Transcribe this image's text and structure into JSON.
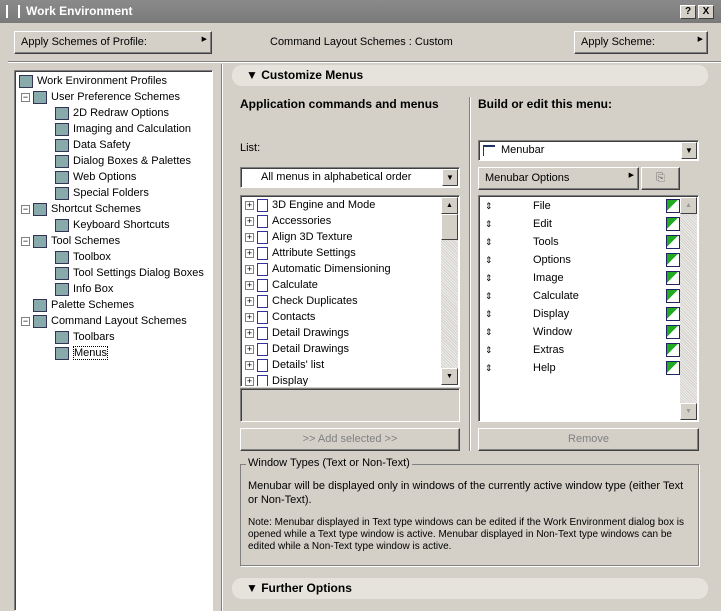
{
  "window": {
    "title": "Work Environment",
    "help": "?",
    "close": "X"
  },
  "toolbar": {
    "apply_profile": "Apply Schemes of Profile:",
    "layout_label": "Command Layout Schemes : Custom",
    "apply_scheme": "Apply Scheme:"
  },
  "tree": [
    {
      "label": "Work Environment Profiles",
      "level": 0,
      "exp": ""
    },
    {
      "label": "User Preference Schemes",
      "level": 1,
      "exp": "−"
    },
    {
      "label": "2D Redraw Options",
      "level": 2
    },
    {
      "label": "Imaging and Calculation",
      "level": 2
    },
    {
      "label": "Data Safety",
      "level": 2
    },
    {
      "label": "Dialog Boxes & Palettes",
      "level": 2
    },
    {
      "label": "Web Options",
      "level": 2
    },
    {
      "label": "Special Folders",
      "level": 2
    },
    {
      "label": "Shortcut Schemes",
      "level": 1,
      "exp": "−"
    },
    {
      "label": "Keyboard Shortcuts",
      "level": 2
    },
    {
      "label": "Tool Schemes",
      "level": 1,
      "exp": "−"
    },
    {
      "label": "Toolbox",
      "level": 2
    },
    {
      "label": "Tool Settings Dialog Boxes",
      "level": 2
    },
    {
      "label": "Info Box",
      "level": 2
    },
    {
      "label": "Palette Schemes",
      "level": 1,
      "exp": ""
    },
    {
      "label": "Command Layout Schemes",
      "level": 1,
      "exp": "−"
    },
    {
      "label": "Toolbars",
      "level": 2
    },
    {
      "label": "Menus",
      "level": 2,
      "selected": true
    }
  ],
  "customize": {
    "header": "Customize Menus",
    "left_heading": "Application commands and menus",
    "right_heading": "Build or edit this menu:",
    "list_label": "List:",
    "list_value": "All menus in alphabetical order",
    "commands": [
      "3D Engine and Mode",
      "Accessories",
      "Align 3D Texture",
      "Attribute Settings",
      "Automatic Dimensioning",
      "Calculate",
      "Check Duplicates",
      "Contacts",
      "Detail Drawings",
      "Detail Drawings",
      "Details' list",
      "Display"
    ],
    "add_selected": ">> Add selected >>",
    "menu_value": "Menubar",
    "menu_options": "Menubar Options",
    "menu_items": [
      "File",
      "Edit",
      "Tools",
      "Options",
      "Image",
      "Calculate",
      "Display",
      "Window",
      "Extras",
      "Help"
    ],
    "remove": "Remove"
  },
  "window_types": {
    "legend": "Window Types (Text or Non-Text)",
    "text1": "Menubar will be displayed only in windows of the currently active window type (either Text or Non-Text).",
    "text2": "Note: Menubar displayed in Text type windows can be edited if the Work Environment dialog box is opened while a Text type window is active. Menubar displayed in Non-Text type windows can be edited while a Non-Text type window is active."
  },
  "further": {
    "header": "Further Options"
  }
}
